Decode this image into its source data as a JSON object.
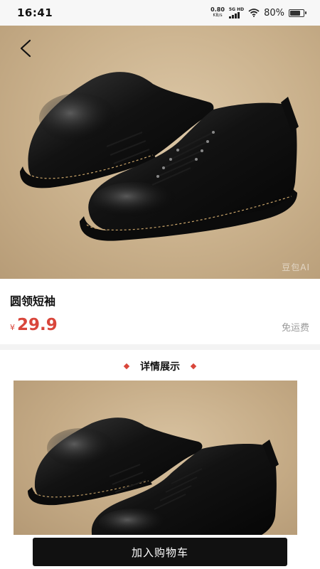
{
  "status_bar": {
    "time": "16:41",
    "net_speed": "0.80",
    "net_unit": "KB/s",
    "network_tag": "5G HD",
    "battery_text": "80%",
    "battery_level": 0.8
  },
  "hero": {
    "back_icon": "chevron-left-icon",
    "watermark": "豆包AI"
  },
  "product": {
    "title": "圆领短袖",
    "currency": "¥",
    "price": "29.9",
    "shipping": "免运费"
  },
  "details": {
    "title": "详情展示"
  },
  "actions": {
    "add_to_cart": "加入购物车"
  },
  "colors": {
    "accent": "#d9463b",
    "button": "#111111"
  }
}
